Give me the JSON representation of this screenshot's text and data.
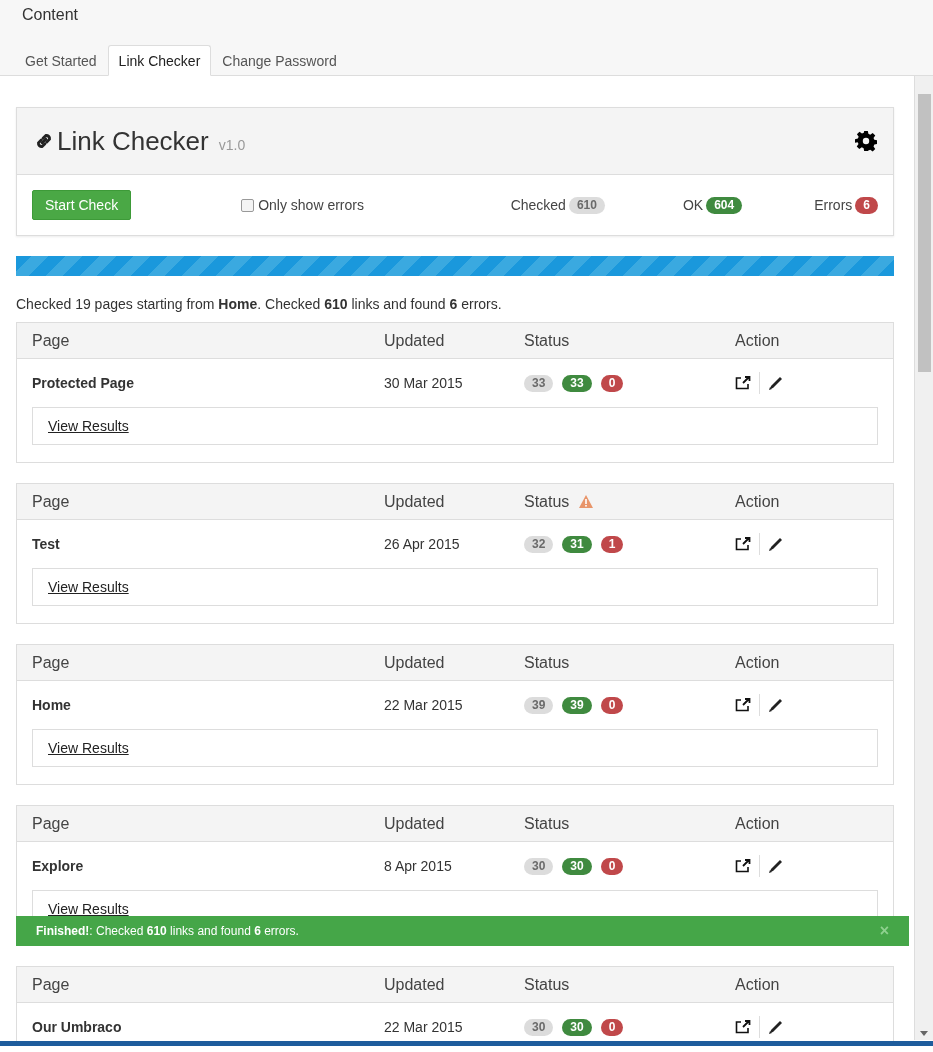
{
  "header": {
    "title": "Content"
  },
  "tabs": [
    {
      "label": "Get Started",
      "selected": false
    },
    {
      "label": "Link Checker",
      "selected": true
    },
    {
      "label": "Change Password",
      "selected": false
    }
  ],
  "panel": {
    "title": "Link Checker",
    "version": "v1.0",
    "start_button": "Start Check",
    "filter": {
      "label": "Only show errors",
      "checked": false
    },
    "stats": [
      {
        "label": "Checked",
        "value": "610",
        "kind": "checked"
      },
      {
        "label": "OK",
        "value": "604",
        "kind": "ok"
      },
      {
        "label": "Errors",
        "value": "6",
        "kind": "errors"
      }
    ]
  },
  "progress": {
    "level": 1
  },
  "summary": "Checked 19 pages starting from **Home**. Checked **610** links and found **6** errors.",
  "results": [
    {
      "columns": [
        "Page",
        "Updated",
        "Status",
        "Action"
      ],
      "page": "Protected Page",
      "updated": "30 Mar 2015",
      "warning": false,
      "checked": "33",
      "ok": "33",
      "errors": "0",
      "link": "View Results"
    },
    {
      "columns": [
        "Page",
        "Updated",
        "Status",
        "Action"
      ],
      "page": "Test",
      "updated": "26 Apr 2015",
      "warning": true,
      "checked": "32",
      "ok": "31",
      "errors": "1",
      "link": "View Results"
    },
    {
      "columns": [
        "Page",
        "Updated",
        "Status",
        "Action"
      ],
      "page": "Home",
      "updated": "22 Mar 2015",
      "warning": false,
      "checked": "39",
      "ok": "39",
      "errors": "0",
      "link": "View Results"
    },
    {
      "columns": [
        "Page",
        "Updated",
        "Status",
        "Action"
      ],
      "page": "Explore",
      "updated": "8 Apr 2015",
      "warning": false,
      "checked": "30",
      "ok": "30",
      "errors": "0",
      "link": "View Results"
    },
    {
      "columns": [
        "Page",
        "Updated",
        "Status",
        "Action"
      ],
      "page": "Our Umbraco",
      "updated": "22 Mar 2015",
      "warning": false,
      "checked": "30",
      "ok": "30",
      "errors": "0"
    }
  ],
  "notice": {
    "text": "**Finished!**: Checked **610** links and found **6** errors.",
    "close": "×"
  }
}
